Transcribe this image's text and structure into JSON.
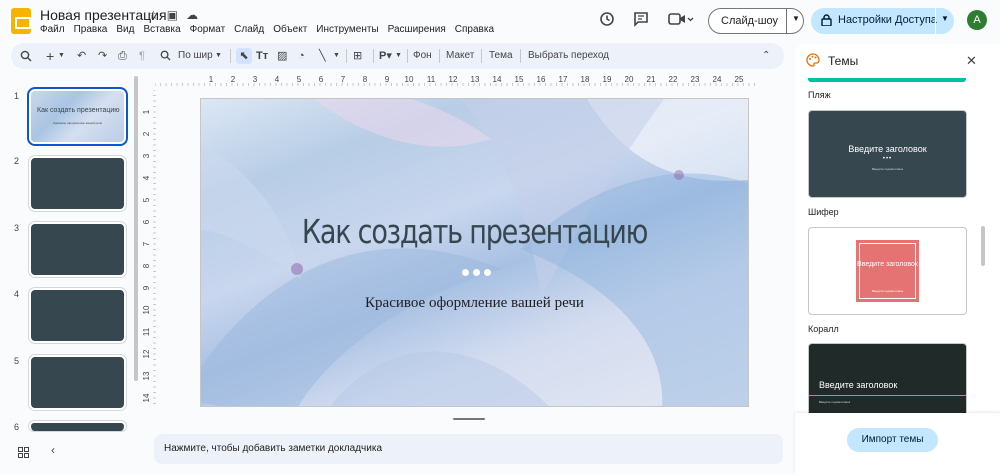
{
  "app": {
    "doc_title": "Новая презентация"
  },
  "menu": [
    "Файл",
    "Правка",
    "Вид",
    "Вставка",
    "Формат",
    "Слайд",
    "Объект",
    "Инструменты",
    "Расширения",
    "Справка"
  ],
  "header": {
    "slideshow_label": "Слайд-шоу",
    "access_label": "Настройки Доступа",
    "avatar_letter": "A"
  },
  "toolbar": {
    "zoom_label": "По шир",
    "bg_label": "Фон",
    "layout_label": "Макет",
    "theme_label": "Тема",
    "transition_label": "Выбрать переход"
  },
  "ruler": {
    "ticks": [
      "1",
      "2",
      "3",
      "4",
      "5",
      "6",
      "7",
      "8",
      "9",
      "10",
      "11",
      "12",
      "13",
      "14",
      "15",
      "16",
      "17",
      "18",
      "19",
      "20",
      "21",
      "22",
      "23",
      "24",
      "25"
    ],
    "vticks": [
      "1",
      "2",
      "3",
      "4",
      "5",
      "6",
      "7",
      "8",
      "9",
      "10",
      "11",
      "12",
      "13",
      "14"
    ]
  },
  "slides": [
    {
      "num": "1",
      "title": "Как создать презентацию",
      "sub": "Красивое оформление вашей речи"
    },
    {
      "num": "2"
    },
    {
      "num": "3"
    },
    {
      "num": "4"
    },
    {
      "num": "5"
    },
    {
      "num": "6"
    }
  ],
  "current_slide": {
    "title": "Как создать презентацию",
    "subtitle": "Красивое оформление вашей речи"
  },
  "notes": {
    "placeholder": "Нажмите, чтобы добавить заметки докладчика"
  },
  "themes": {
    "title": "Темы",
    "items": [
      {
        "name": "Пляж"
      },
      {
        "name": "Шифер",
        "heading": "Введите заголовок",
        "dots": "•••",
        "sub": "Введите подзаголовок"
      },
      {
        "name": "Коралл",
        "heading": "Введите заголовок",
        "sub": "Введите подзаголовок"
      },
      {
        "heading": "Введите заголовок",
        "sub": "Введите подзаголовок"
      }
    ],
    "import_label": "Импорт темы"
  },
  "colors": {
    "accent": "#0b57d0",
    "access_bg": "#c2e7ff",
    "slate": "#37474f",
    "coral": "#e57373",
    "beach": "#00bfa5"
  }
}
